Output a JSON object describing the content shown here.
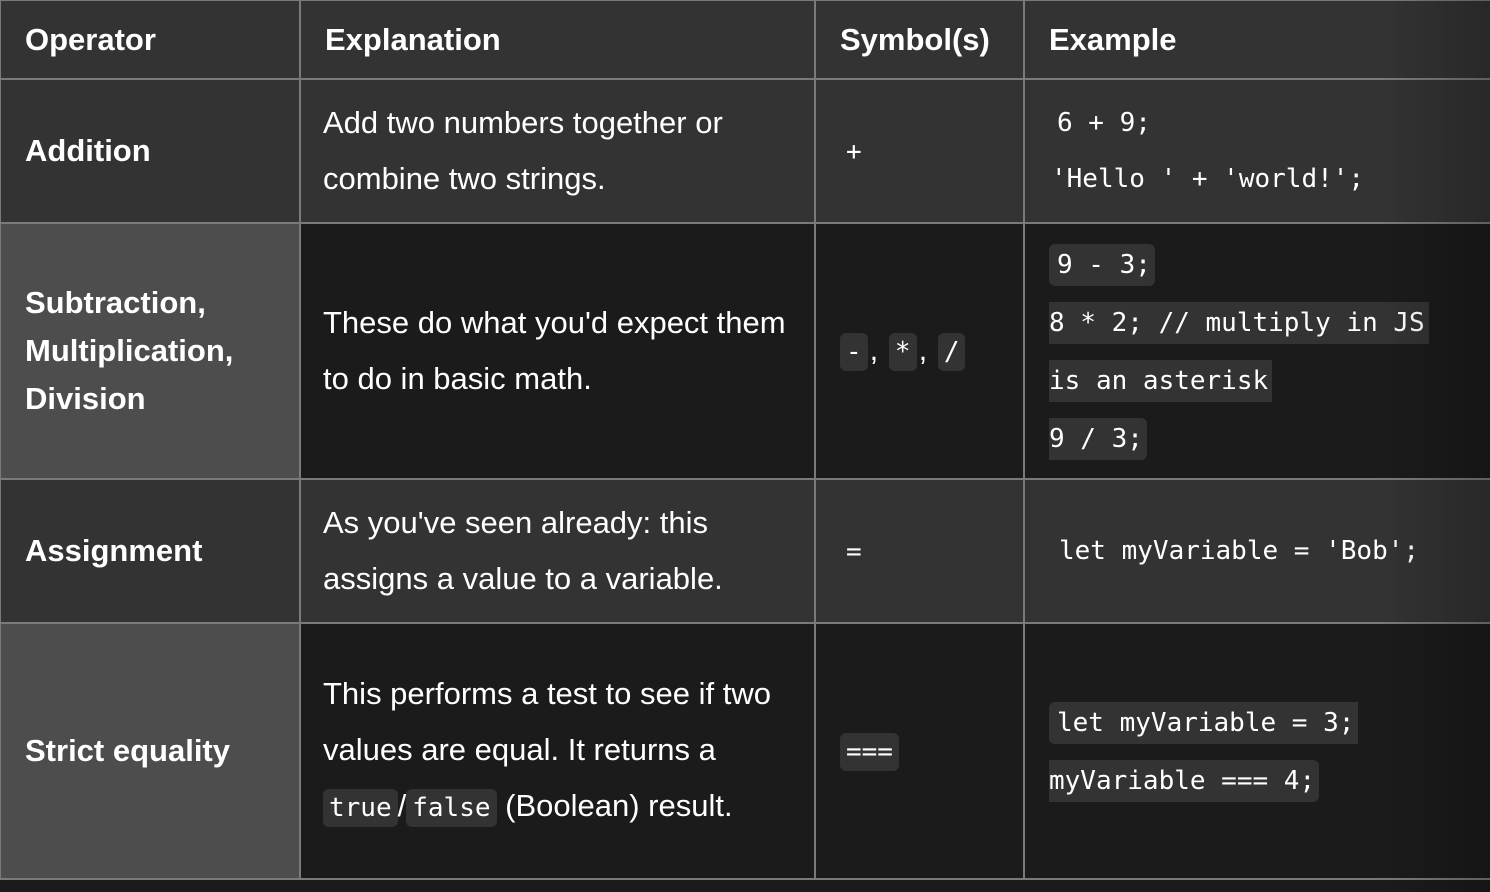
{
  "table": {
    "headers": [
      "Operator",
      "Explanation",
      "Symbol(s)",
      "Example"
    ],
    "rows": [
      {
        "operator": "Addition",
        "explanation": "Add two numbers together or combine two strings.",
        "symbols": [
          "+"
        ],
        "example_lines": [
          "6 + 9;",
          "'Hello ' + 'world!';"
        ]
      },
      {
        "operator": "Subtraction, Multiplication, Division",
        "explanation": "These do what you'd expect them to do in basic math.",
        "symbols": [
          "-",
          "*",
          "/"
        ],
        "symbol_separator": ",",
        "example_lines": [
          "9 - 3;",
          "8 * 2; // multiply in JS",
          "is an asterisk",
          "9 / 3;"
        ]
      },
      {
        "operator": "Assignment",
        "explanation": "As you've seen already: this assigns a value to a variable.",
        "symbols": [
          "="
        ],
        "example_lines": [
          "let myVariable = 'Bob';"
        ]
      },
      {
        "operator": "Strict equality",
        "explanation_parts": {
          "before": "This performs a test to see if two values are equal. It returns a ",
          "code1": "true",
          "slash": "/",
          "code2": "false",
          "after": " (Boolean) result."
        },
        "symbols": [
          "==="
        ],
        "example_lines": [
          "let myVariable = 3;",
          "myVariable === 4;"
        ]
      }
    ]
  },
  "colors": {
    "header_bg": "#333333",
    "odd_row_bg": "#333333",
    "even_row_bg": "#1b1b1b",
    "even_row_header_bg": "#4d4d4d",
    "border": "#7a7a7a",
    "code_bg": "#333333",
    "text": "#ffffff"
  }
}
